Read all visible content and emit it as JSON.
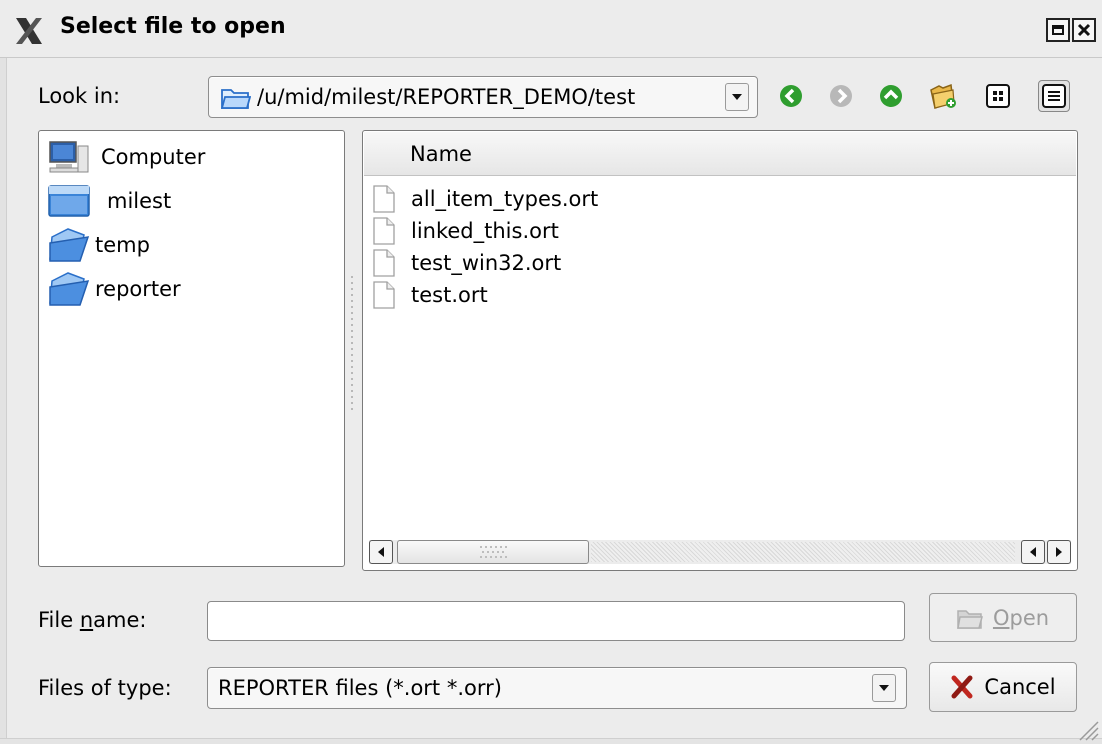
{
  "window": {
    "title": "Select file to open"
  },
  "look_in": {
    "label": "Look in:",
    "path": "/u/mid/milest/REPORTER_DEMO/test"
  },
  "nav_icons": [
    "back-icon",
    "forward-icon",
    "parent-directory-icon",
    "new-folder-icon",
    "list-view-icon",
    "detail-view-icon"
  ],
  "sidebar": {
    "items": [
      {
        "label": "Computer",
        "icon": "computer-icon"
      },
      {
        "label": "milest",
        "icon": "home-folder-icon"
      },
      {
        "label": "temp",
        "icon": "folder-icon"
      },
      {
        "label": "reporter",
        "icon": "folder-icon"
      }
    ]
  },
  "file_list": {
    "column_header": "Name",
    "files": [
      {
        "name": "all_item_types.ort",
        "icon": "file-icon"
      },
      {
        "name": "linked_this.ort",
        "icon": "file-icon"
      },
      {
        "name": "test_win32.ort",
        "icon": "file-icon"
      },
      {
        "name": "test.ort",
        "icon": "file-icon"
      }
    ]
  },
  "file_name": {
    "label_pre": "File ",
    "label_mnemonic": "n",
    "label_post": "ame:",
    "value": ""
  },
  "open_button": {
    "label_mnemonic": "O",
    "label_post": "pen",
    "enabled": false
  },
  "file_type": {
    "label": "Files of type:",
    "value": "REPORTER files (*.ort *.orr)"
  },
  "cancel_button": {
    "label": "Cancel"
  },
  "colors": {
    "nav_green": "#2f9e2f",
    "nav_disabled": "#b8b8b8",
    "folder_blue": "#3a84d8",
    "cancel_x_red": "#c0271f"
  }
}
